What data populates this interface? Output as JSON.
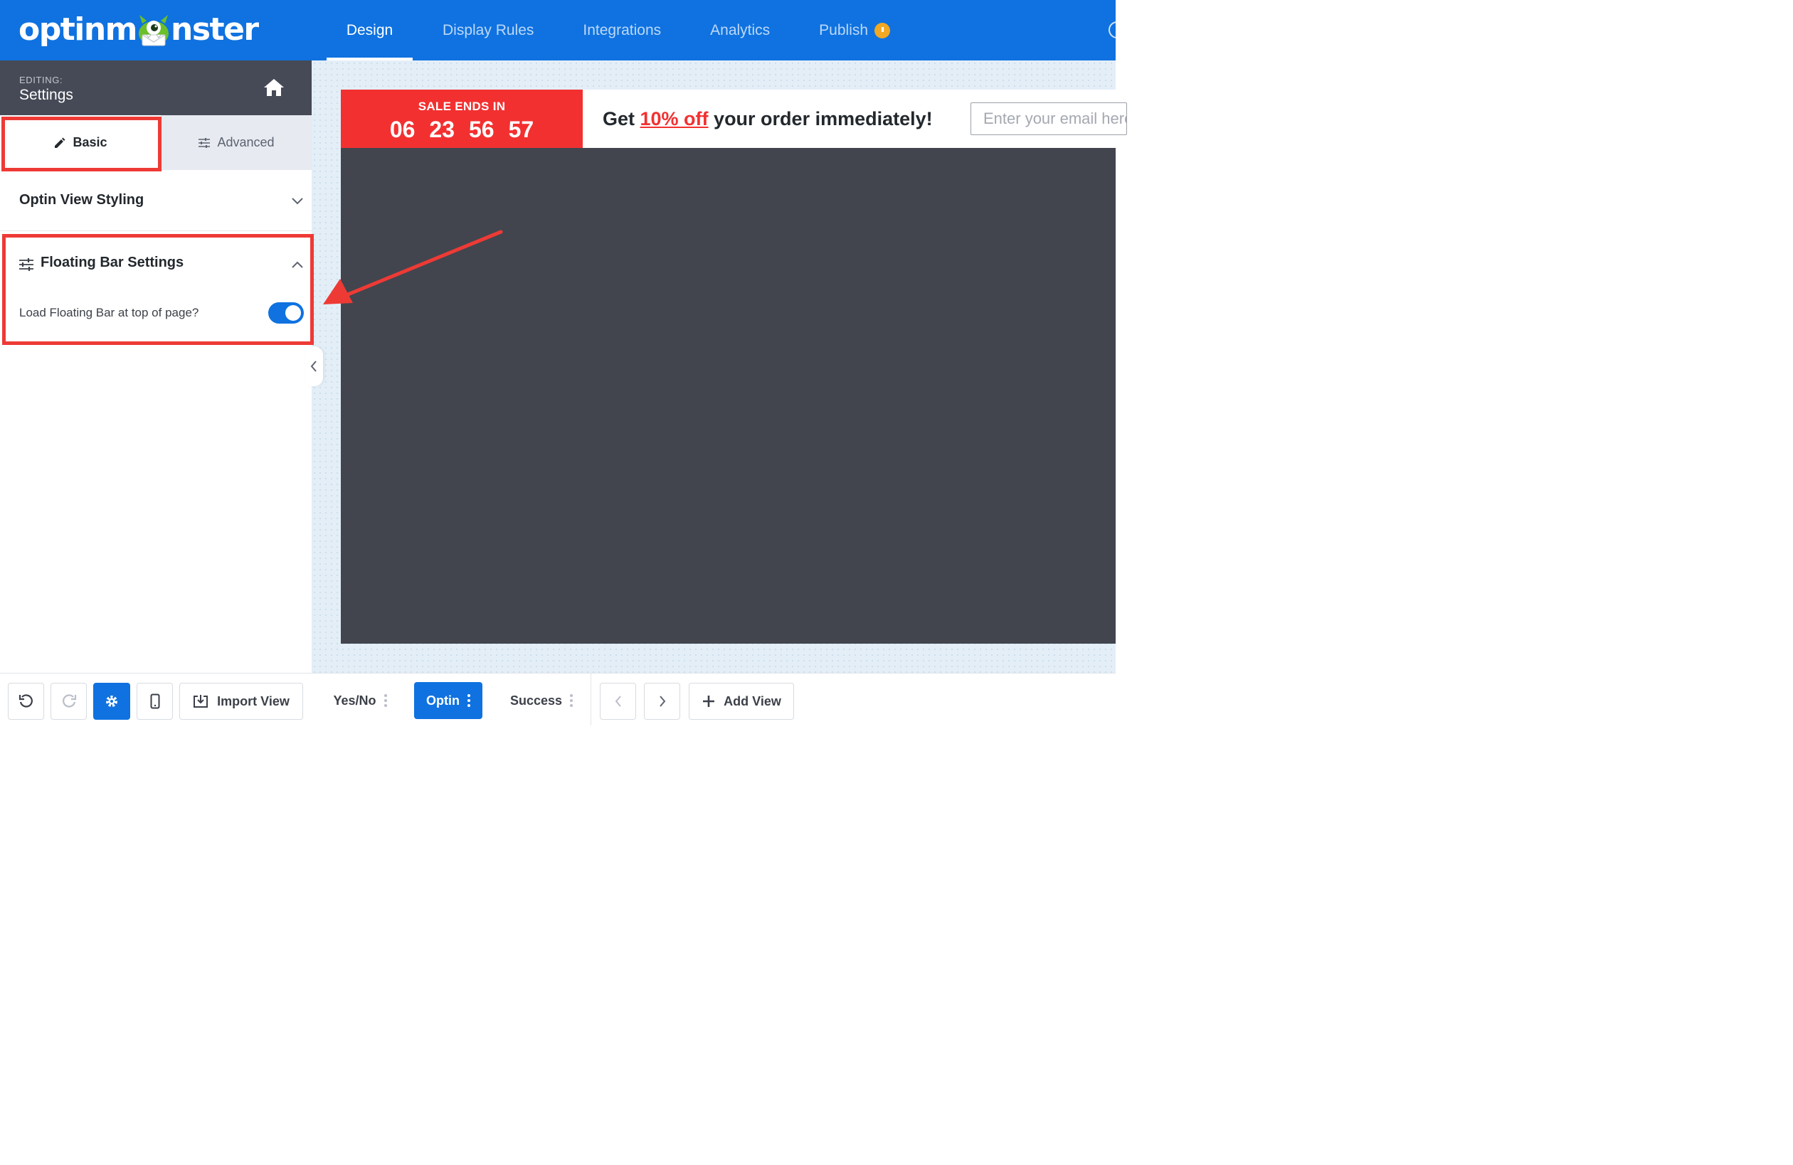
{
  "header": {
    "logo_left": "optinm",
    "logo_right": "nster",
    "tabs": [
      {
        "label": "Design",
        "active": true
      },
      {
        "label": "Display Rules",
        "active": false
      },
      {
        "label": "Integrations",
        "active": false
      },
      {
        "label": "Analytics",
        "active": false
      },
      {
        "label": "Publish",
        "active": false,
        "badge": "paused"
      }
    ]
  },
  "sidebar": {
    "editing_label": "EDITING:",
    "editing_title": "Settings",
    "tab_basic": "Basic",
    "tab_advanced": "Advanced",
    "section_styling": "Optin View Styling",
    "section_floating": "Floating Bar Settings",
    "toggle_label": "Load Floating Bar at top of page?",
    "toggle_on": true
  },
  "preview": {
    "countdown_label": "SALE ENDS IN",
    "countdown": [
      "06",
      "23",
      "56",
      "57"
    ],
    "headline_pre": "Get ",
    "headline_highlight": "10% off",
    "headline_post": " your order immediately!",
    "email_placeholder": "Enter your email here"
  },
  "bottom": {
    "import_view": "Import View",
    "views": [
      {
        "label": "Yes/No",
        "active": false
      },
      {
        "label": "Optin",
        "active": true
      },
      {
        "label": "Success",
        "active": false
      }
    ],
    "add_view": "Add View"
  },
  "colors": {
    "brand_blue": "#0f72e0",
    "sidebar_dark": "#464a56",
    "highlight_red": "#ee3a35",
    "countdown_red": "#f33030",
    "preview_dark": "#42454e",
    "monster_green": "#6bbf2a"
  }
}
